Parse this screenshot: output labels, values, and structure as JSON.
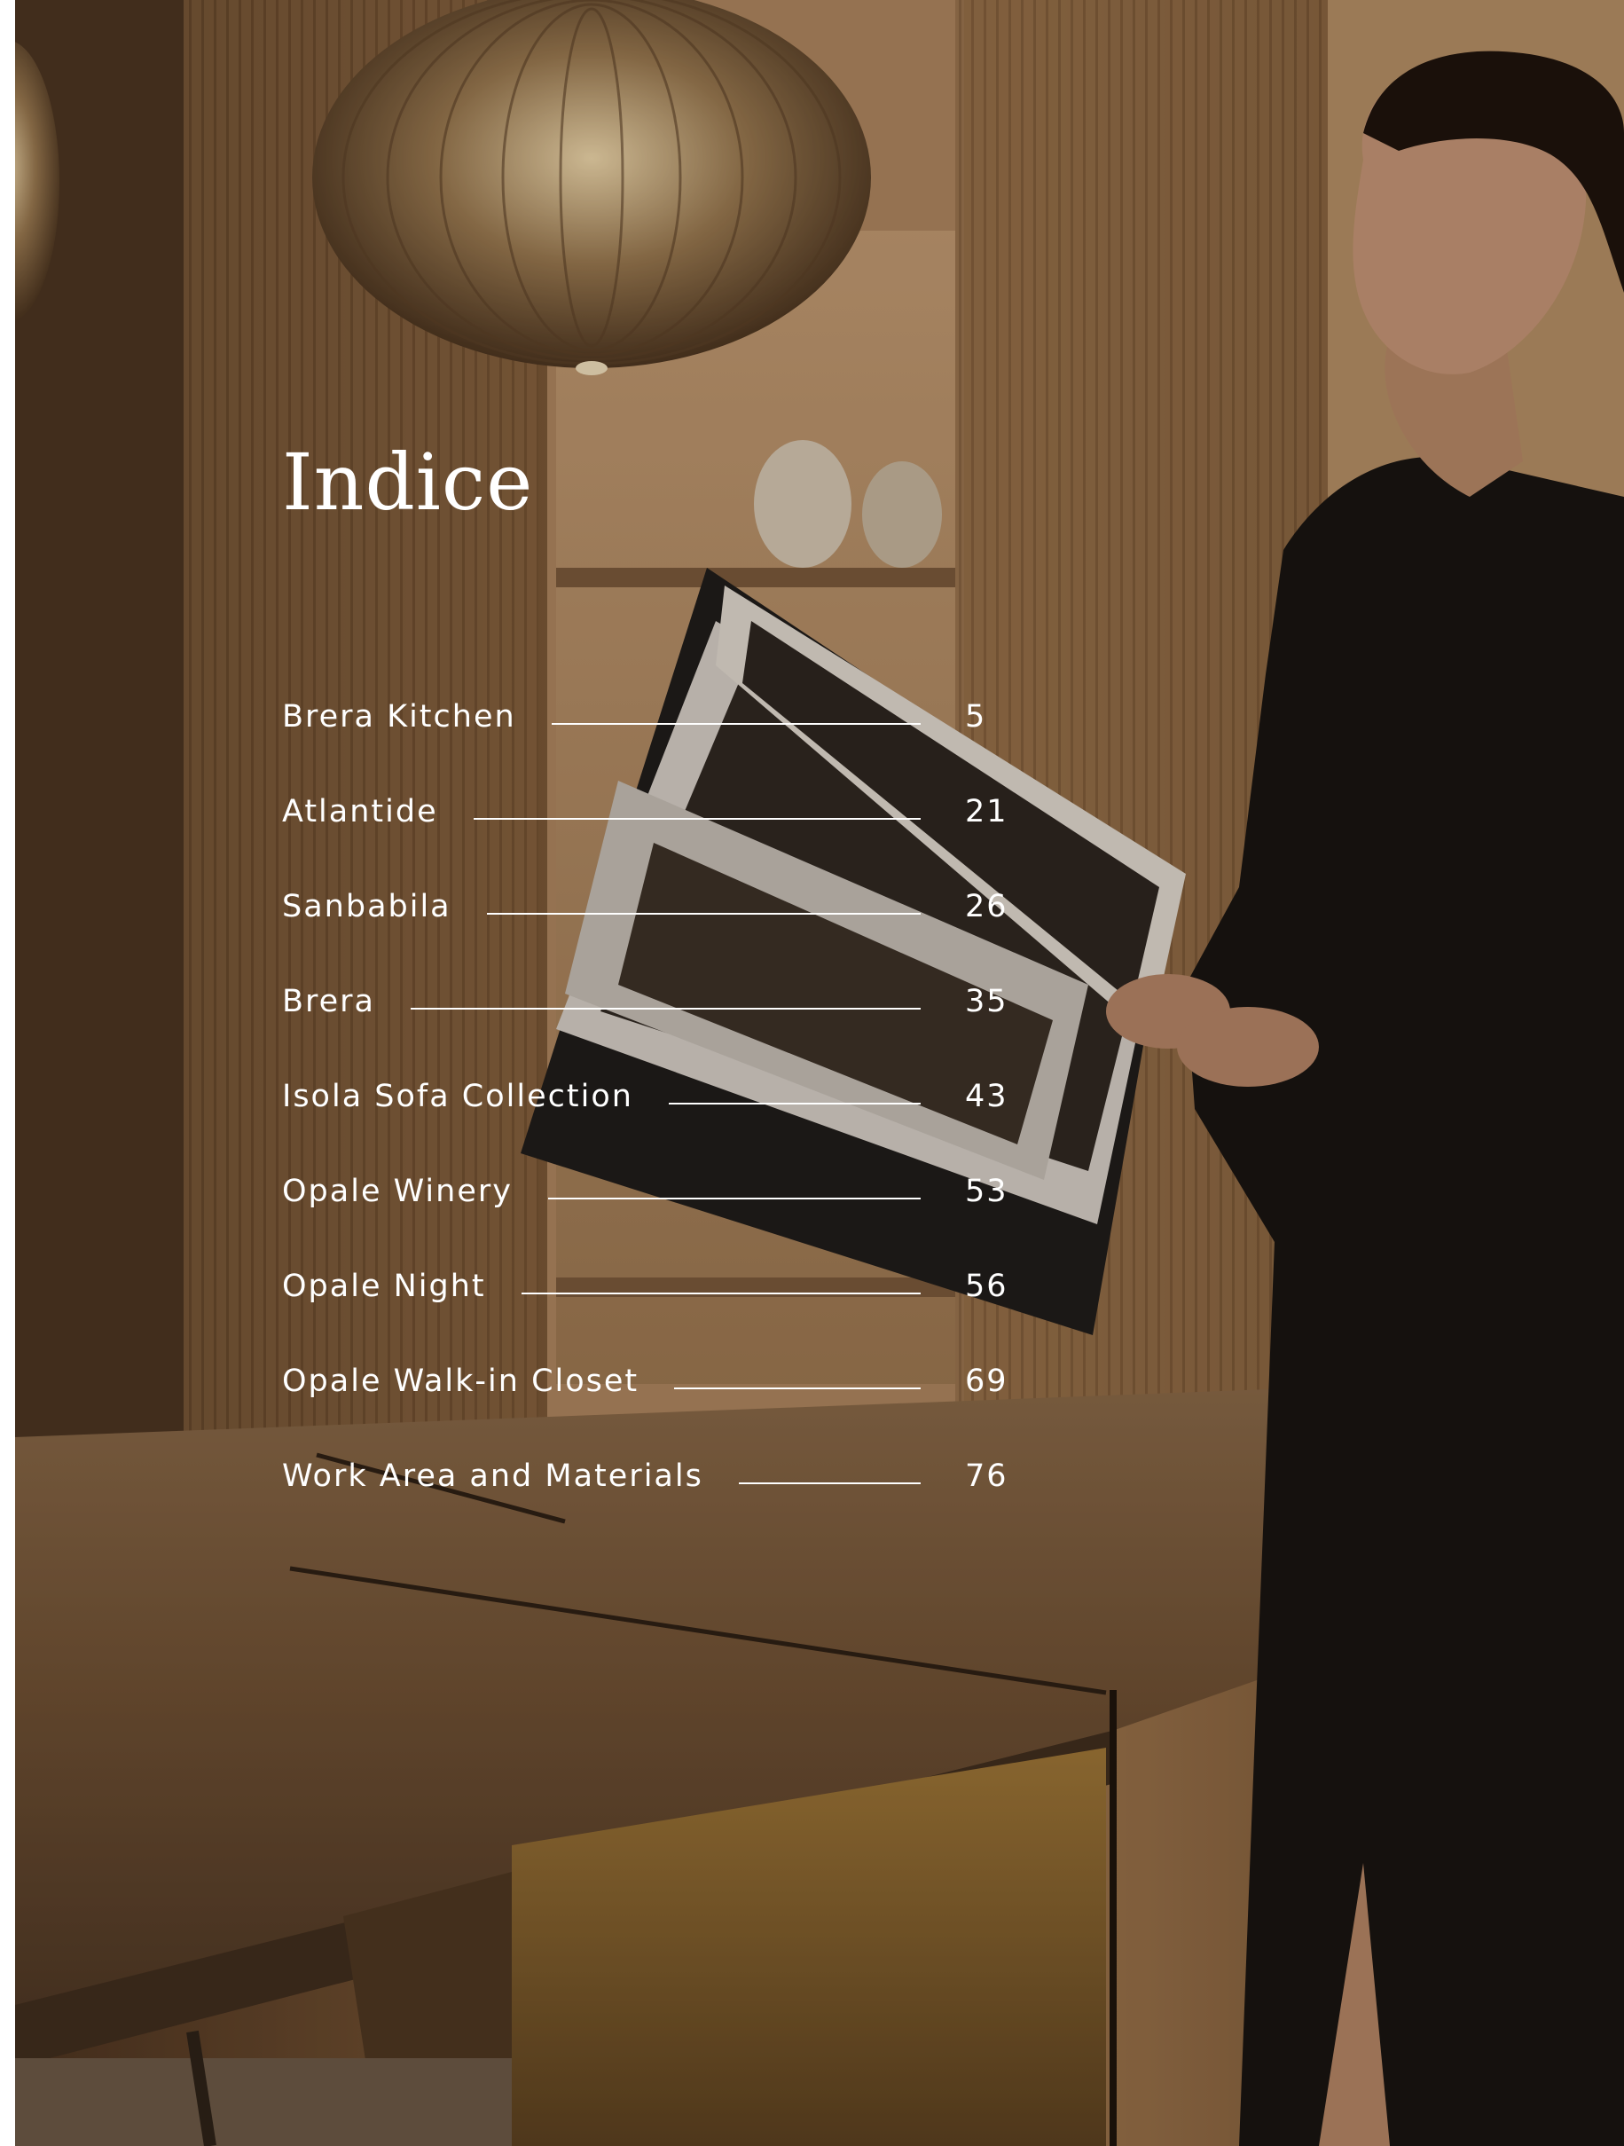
{
  "page": {
    "title": "Indice"
  },
  "toc": [
    {
      "label": "Brera Kitchen",
      "page": "5"
    },
    {
      "label": "Atlantide",
      "page": "21"
    },
    {
      "label": "Sanbabila",
      "page": "26"
    },
    {
      "label": "Brera",
      "page": "35"
    },
    {
      "label": "Isola Sofa Collection",
      "page": "43"
    },
    {
      "label": "Opale Winery",
      "page": "53"
    },
    {
      "label": "Opale Night",
      "page": "56"
    },
    {
      "label": "Opale Walk-in Closet",
      "page": "69"
    },
    {
      "label": "Work Area and Materials",
      "page": "76"
    }
  ],
  "colors": {
    "text": "#ffffff",
    "page_margin": "#ffffff",
    "wood_dark": "#3a2616",
    "wood_warm": "#8a6440",
    "garment": "#141210"
  }
}
